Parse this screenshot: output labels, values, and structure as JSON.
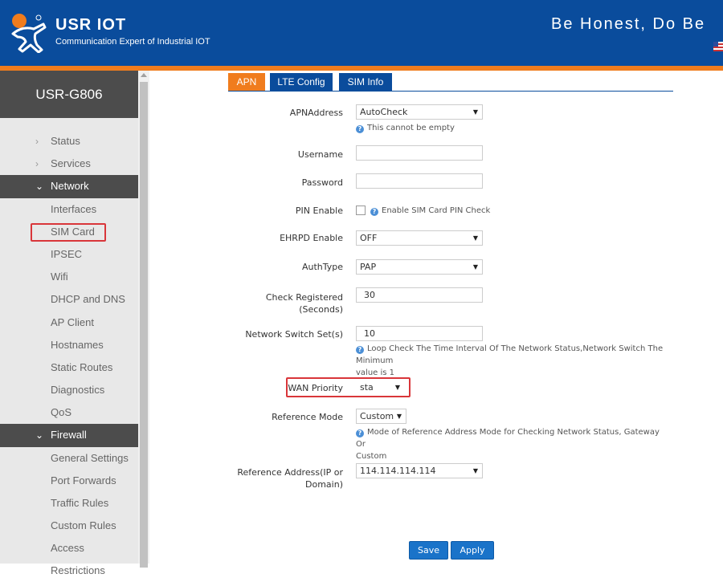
{
  "header": {
    "brand": "USR IOT",
    "brand_sub": "Communication Expert of Industrial IOT",
    "slogan": "Be Honest, Do Be"
  },
  "sidebar": {
    "device_name": "USR-G806",
    "items": [
      {
        "label": "Status",
        "type": "top"
      },
      {
        "label": "Services",
        "type": "top"
      },
      {
        "label": "Network",
        "type": "top-active"
      },
      {
        "label": "Interfaces",
        "type": "sub"
      },
      {
        "label": "SIM Card",
        "type": "sub-selected"
      },
      {
        "label": "IPSEC",
        "type": "sub"
      },
      {
        "label": "Wifi",
        "type": "sub"
      },
      {
        "label": "DHCP and DNS",
        "type": "sub"
      },
      {
        "label": "AP Client",
        "type": "sub"
      },
      {
        "label": "Hostnames",
        "type": "sub"
      },
      {
        "label": "Static Routes",
        "type": "sub"
      },
      {
        "label": "Diagnostics",
        "type": "sub"
      },
      {
        "label": "QoS",
        "type": "sub"
      },
      {
        "label": "Firewall",
        "type": "top-active"
      },
      {
        "label": "General Settings",
        "type": "sub"
      },
      {
        "label": "Port Forwards",
        "type": "sub"
      },
      {
        "label": "Traffic Rules",
        "type": "sub"
      },
      {
        "label": "Custom Rules",
        "type": "sub"
      },
      {
        "label": "Access Restrictions",
        "type": "sub"
      }
    ]
  },
  "tabs": [
    {
      "label": "APN",
      "active": true
    },
    {
      "label": "LTE Config",
      "active": false
    },
    {
      "label": "SIM Info",
      "active": false
    }
  ],
  "form": {
    "apn_address": {
      "label": "APNAddress",
      "value": "AutoCheck",
      "hint": "This cannot be empty"
    },
    "username": {
      "label": "Username",
      "value": ""
    },
    "password": {
      "label": "Password",
      "value": ""
    },
    "pin_enable": {
      "label": "PIN Enable",
      "checked": false,
      "hint": "Enable SIM Card PIN Check"
    },
    "ehrpd_enable": {
      "label": "EHRPD Enable",
      "value": "OFF"
    },
    "auth_type": {
      "label": "AuthType",
      "value": "PAP"
    },
    "check_registered": {
      "label_line1": "Check Registered",
      "label_line2": "(Seconds)",
      "value": "30"
    },
    "network_switch": {
      "label": "Network Switch Set(s)",
      "value": "10",
      "hint_line1": "Loop Check The Time Interval Of The Network Status,Network Switch The Minimum",
      "hint_line2": "value is 1"
    },
    "wan_priority": {
      "label": "WAN Priority",
      "value": "sta"
    },
    "reference_mode": {
      "label": "Reference Mode",
      "value": "Custom",
      "hint_line1": "Mode of Reference Address Mode for Checking Network Status, Gateway Or",
      "hint_line2": "Custom"
    },
    "reference_address": {
      "label_line1": "Reference Address(IP or",
      "label_line2": "Domain)",
      "value": "114.114.114.114"
    }
  },
  "buttons": {
    "save": "Save",
    "apply": "Apply"
  },
  "colors": {
    "header_blue": "#0a4c9c",
    "accent_orange": "#f07c1d",
    "sidebar_dark": "#4c4c4c",
    "highlight_red": "#d9363a",
    "button_blue": "#1a73c9"
  }
}
